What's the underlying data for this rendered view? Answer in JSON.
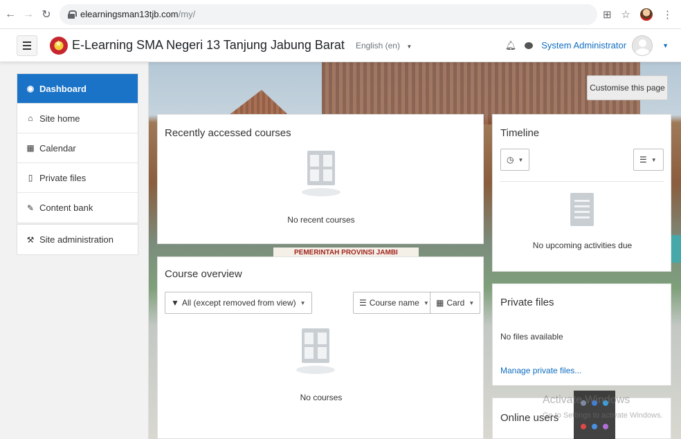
{
  "browser": {
    "url_domain": "elearningsman13tjb.com",
    "url_path": "/my/"
  },
  "navbar": {
    "site_name": "E-Learning SMA Negeri 13 Tanjung Jabung Barat",
    "language": "English (en)",
    "user_name": "System Administrator"
  },
  "sidebar": {
    "items": [
      {
        "label": "Dashboard",
        "icon": "dashboard-icon",
        "active": true
      },
      {
        "label": "Site home",
        "icon": "home-icon"
      },
      {
        "label": "Calendar",
        "icon": "calendar-icon"
      },
      {
        "label": "Private files",
        "icon": "file-icon"
      },
      {
        "label": "Content bank",
        "icon": "brush-icon"
      }
    ],
    "admin": {
      "label": "Site administration",
      "icon": "wrench-icon"
    }
  },
  "customise_button": "Customise this page",
  "recent_courses": {
    "title": "Recently accessed courses",
    "empty_text": "No recent courses"
  },
  "timeline": {
    "title": "Timeline",
    "empty_text": "No upcoming activities due"
  },
  "course_overview": {
    "title": "Course overview",
    "filter_label": "All (except removed from view)",
    "sort_label": "Course name",
    "view_label": "Card",
    "empty_text": "No courses"
  },
  "private_files": {
    "title": "Private files",
    "empty_text": "No files available",
    "manage_link": "Manage private files..."
  },
  "online_users": {
    "title": "Online users"
  },
  "background": {
    "banner_text": "PEMERINTAH PROVINSI JAMBI"
  },
  "windows_watermark": {
    "title": "Activate Windows",
    "subtitle": "Go to Settings to activate Windows."
  },
  "colors": {
    "accent": "#1a73c7",
    "link": "#0f6cbf"
  }
}
